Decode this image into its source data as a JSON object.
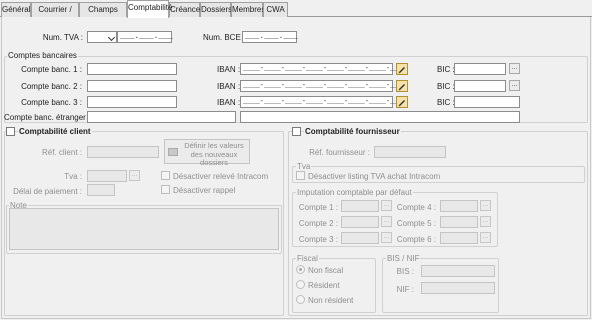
{
  "tabs": [
    {
      "label": "Général"
    },
    {
      "label": "Courrier / autre"
    },
    {
      "label": "Champs extras"
    },
    {
      "label": "Comptabilité"
    },
    {
      "label": "Créance"
    },
    {
      "label": "Dossiers"
    },
    {
      "label": "Membres"
    },
    {
      "label": "CWA"
    }
  ],
  "active_tab": "Comptabilité",
  "header": {
    "tva_label": "Num. TVA :",
    "tva_mask": "___.___.___",
    "bce_label": "Num. BCE :",
    "bce_mask": "___.___.___"
  },
  "bank": {
    "group_title": "Comptes bancaires",
    "rows": [
      {
        "label": "Compte banc. 1 :",
        "iban_label": "IBAN :",
        "iban_mask": "____-____-____-____-____-____-____-__",
        "bic_label": "BIC :"
      },
      {
        "label": "Compte banc. 2 :",
        "iban_label": "IBAN :",
        "iban_mask": "____-____-____-____-____-____-____-__",
        "bic_label": "BIC :"
      },
      {
        "label": "Compte banc. 3 :",
        "iban_label": "IBAN :",
        "iban_mask": "____-____-____-____-____-____-____-__",
        "bic_label": "BIC :"
      }
    ],
    "foreign_label": "Compte banc. étranger :",
    "browse_symbol": "..."
  },
  "client": {
    "title": "Comptabilité client",
    "ref_label": "Réf. client :",
    "define_button": "Définir les valeurs des nouveaux dossiers",
    "tva_label": "Tva :",
    "delay_label": "Délai de paiement :",
    "intracom_label": "Désactiver relevé Intracom",
    "rappel_label": "Désactiver rappel",
    "note_title": "Note"
  },
  "supplier": {
    "title": "Comptabilité fournisseur",
    "ref_label": "Réf. fournisseur :",
    "tva_group": "Tva",
    "tva_listing_label": "Désactiver listing TVA achat Intracom",
    "imputation_group": "Imputation comptable par défaut",
    "comptes": [
      "Compte 1 :",
      "Compte 2 :",
      "Compte 3 :",
      "Compte 4 :",
      "Compte 5 :",
      "Compte 6 :"
    ],
    "fiscal_group": "Fiscal",
    "fiscal_options": [
      "Non fiscal",
      "Résident",
      "Non résident"
    ],
    "fiscal_selected": "Non fiscal",
    "bisnif_group": "BIS / NIF",
    "bis_label": "BIS :",
    "nif_label": "NIF :"
  },
  "colors": {
    "active_tab": "#ffffff",
    "tab": "#e6e6e6",
    "panel": "#f0f0f0",
    "pencil": "#f3e3a8"
  }
}
